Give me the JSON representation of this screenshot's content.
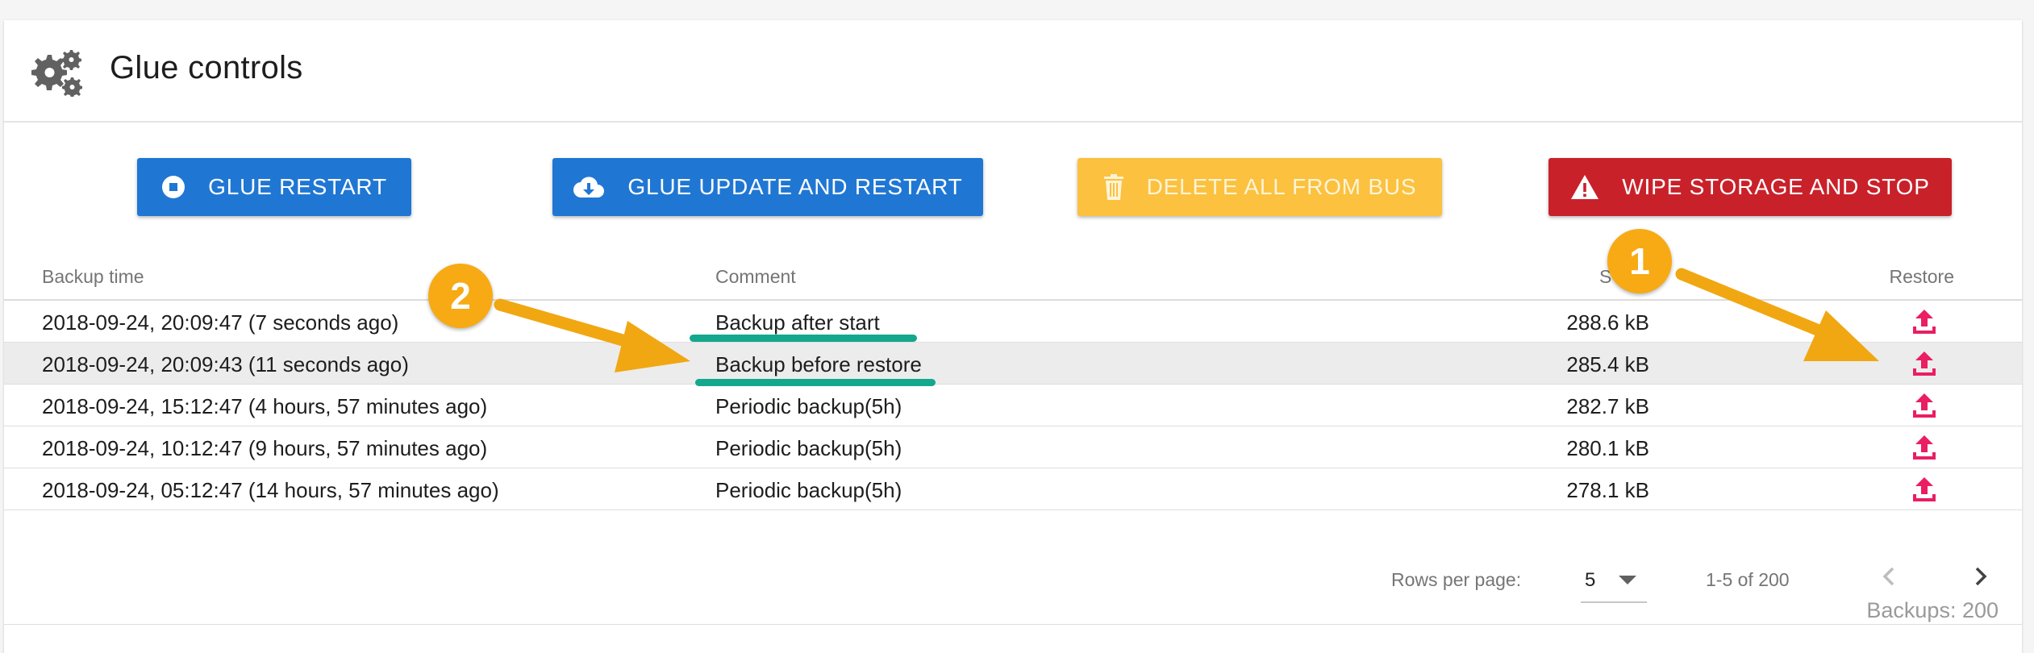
{
  "header": {
    "title": "Glue controls",
    "icon": "gears-icon"
  },
  "actions": {
    "restart": {
      "label": "GLUE RESTART",
      "icon": "stop-circle-icon"
    },
    "update": {
      "label": "GLUE UPDATE AND RESTART",
      "icon": "cloud-download-icon"
    },
    "delete": {
      "label": "DELETE ALL FROM BUS",
      "icon": "trash-icon"
    },
    "wipe": {
      "label": "WIPE STORAGE AND STOP",
      "icon": "warning-icon"
    }
  },
  "table": {
    "columns": {
      "time": "Backup time",
      "comment": "Comment",
      "size": "S",
      "restore": "Restore"
    },
    "rows": [
      {
        "time": "2018-09-24, 20:09:47 (7 seconds ago)",
        "comment": "Backup after start",
        "size": "288.6 kB"
      },
      {
        "time": "2018-09-24, 20:09:43 (11 seconds ago)",
        "comment": "Backup before restore",
        "size": "285.4 kB"
      },
      {
        "time": "2018-09-24, 15:12:47 (4 hours, 57 minutes ago)",
        "comment": "Periodic backup(5h)",
        "size": "282.7 kB"
      },
      {
        "time": "2018-09-24, 10:12:47 (9 hours, 57 minutes ago)",
        "comment": "Periodic backup(5h)",
        "size": "280.1 kB"
      },
      {
        "time": "2018-09-24, 05:12:47 (14 hours, 57 minutes ago)",
        "comment": "Periodic backup(5h)",
        "size": "278.1 kB"
      }
    ],
    "restore_icon": "upload-icon"
  },
  "pagination": {
    "rows_per_page_label": "Rows per page:",
    "rows_per_page_value": "5",
    "range": "1-5 of 200"
  },
  "summary": {
    "total": "Backups: 200"
  },
  "annotations": {
    "badge_1": "1",
    "badge_2": "2"
  },
  "colors": {
    "primary": "#1f77d3",
    "warning": "#fbc13f",
    "danger": "#c9212a",
    "restore_icon": "#e91e63",
    "annotation_badge": "#f7aa13",
    "annotation_underline": "#13a88d"
  }
}
